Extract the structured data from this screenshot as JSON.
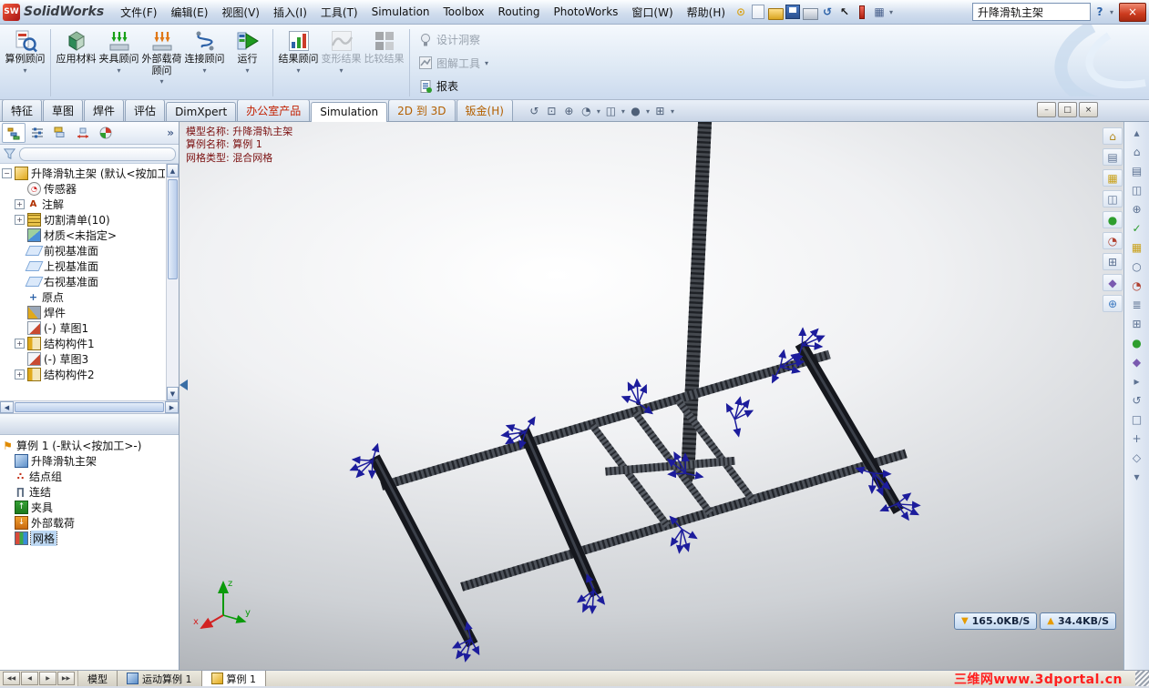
{
  "titlebar": {
    "app_name": "SolidWorks",
    "menus": [
      "文件(F)",
      "编辑(E)",
      "视图(V)",
      "插入(I)",
      "工具(T)",
      "Simulation",
      "Toolbox",
      "Routing",
      "PhotoWorks",
      "窗口(W)",
      "帮助(H)"
    ],
    "search_value": "升降滑轨主架",
    "help_label": "?"
  },
  "ribbon": {
    "buttons": [
      {
        "label": "算例顾问"
      },
      {
        "label": "应用材料"
      },
      {
        "label": "夹具顾问"
      },
      {
        "label": "外部载荷顾问"
      },
      {
        "label": "连接顾问"
      },
      {
        "label": "运行"
      },
      {
        "label": "结果顾问"
      },
      {
        "label": "变形结果"
      },
      {
        "label": "比较结果"
      }
    ],
    "side_buttons": [
      {
        "label": "设计洞察"
      },
      {
        "label": "图解工具"
      },
      {
        "label": "报表"
      }
    ]
  },
  "command_tabs": {
    "tabs": [
      "特征",
      "草图",
      "焊件",
      "评估",
      "DimXpert",
      "办公室产品",
      "Simulation",
      "2D 到 3D",
      "钣金(H)"
    ]
  },
  "feature_tree": {
    "root": "升降滑轨主架 (默认<按加工><",
    "items": [
      {
        "label": "传感器"
      },
      {
        "label": "注解"
      },
      {
        "label": "切割清单(10)"
      },
      {
        "label": "材质<未指定>"
      },
      {
        "label": "前视基准面"
      },
      {
        "label": "上视基准面"
      },
      {
        "label": "右视基准面"
      },
      {
        "label": "原点"
      },
      {
        "label": "焊件"
      },
      {
        "label": "(-) 草图1"
      },
      {
        "label": "结构构件1"
      },
      {
        "label": "(-) 草图3"
      },
      {
        "label": "结构构件2"
      }
    ]
  },
  "study_tree": {
    "items": [
      {
        "label": "算例 1 (-默认<按加工>-)"
      },
      {
        "label": "升降滑轨主架"
      },
      {
        "label": "结点组"
      },
      {
        "label": "连结"
      },
      {
        "label": "夹具"
      },
      {
        "label": "外部载荷"
      },
      {
        "label": "网格"
      }
    ]
  },
  "viewport": {
    "info": {
      "line1": "模型名称: 升降滑轨主架",
      "line2": "算例名称: 算例 1",
      "line3": "网格类型: 混合网格"
    },
    "triad": {
      "x": "x",
      "y": "y",
      "z": "z"
    },
    "download": "165.0KB/S",
    "upload": "34.4KB/S"
  },
  "bottom_bar": {
    "tabs": [
      "模型",
      "运动算例 1",
      "算例 1"
    ],
    "watermark": "三维网www.3dportal.cn"
  }
}
